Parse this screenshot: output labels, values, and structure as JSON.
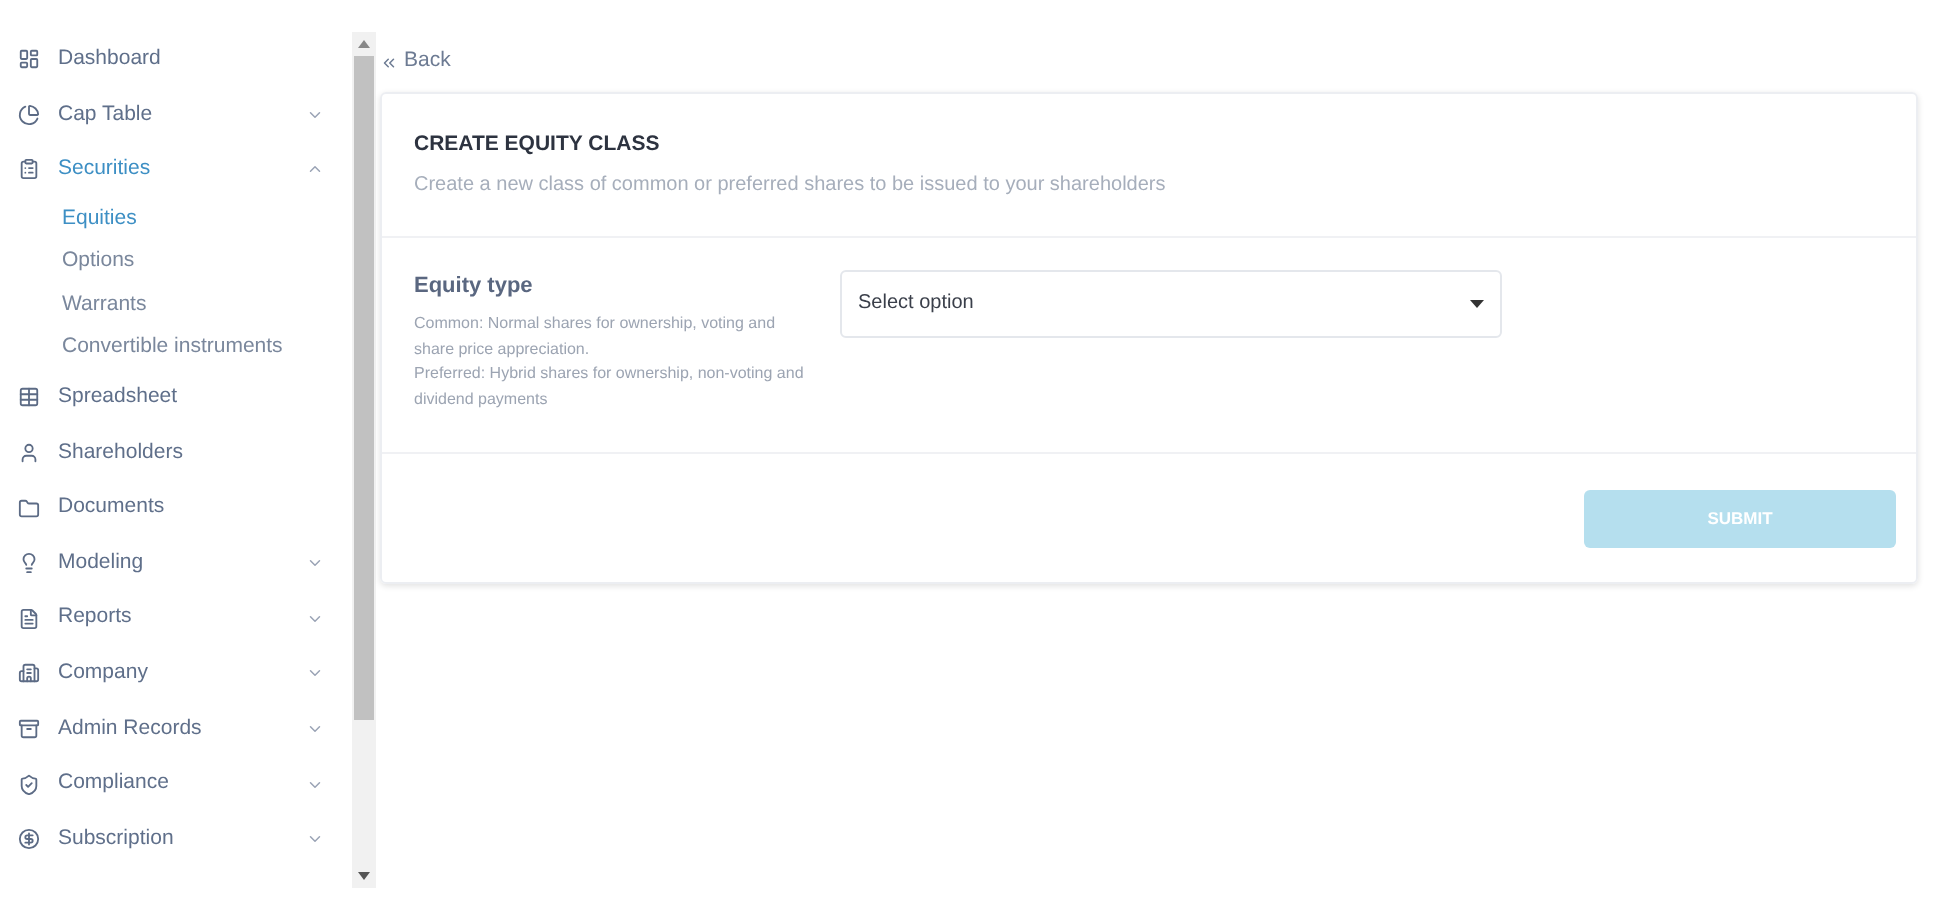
{
  "sidebar": {
    "items": [
      {
        "label": "Dashboard",
        "selected": false
      },
      {
        "label": "Cap Table",
        "selected": false,
        "expanded": false
      },
      {
        "label": "Securities",
        "selected": true,
        "expanded": true,
        "children": [
          {
            "label": "Equities",
            "selected": true
          },
          {
            "label": "Options",
            "selected": false
          },
          {
            "label": "Warrants",
            "selected": false
          },
          {
            "label": "Convertible instruments",
            "selected": false
          }
        ]
      },
      {
        "label": "Spreadsheet",
        "selected": false
      },
      {
        "label": "Shareholders",
        "selected": false
      },
      {
        "label": "Documents",
        "selected": false
      },
      {
        "label": "Modeling",
        "selected": false,
        "expanded": false
      },
      {
        "label": "Reports",
        "selected": false,
        "expanded": false
      },
      {
        "label": "Company",
        "selected": false,
        "expanded": false
      },
      {
        "label": "Admin Records",
        "selected": false,
        "expanded": false
      },
      {
        "label": "Compliance",
        "selected": false,
        "expanded": false
      },
      {
        "label": "Subscription",
        "selected": false,
        "expanded": false
      }
    ]
  },
  "back_link": "Back",
  "card": {
    "title": "CREATE EQUITY CLASS",
    "subtitle": "Create a new class of common or preferred shares to be issued to your shareholders",
    "field": {
      "label": "Equity type",
      "help": [
        "Common: Normal shares for ownership, voting and share price appreciation.",
        "Preferred: Hybrid shares for ownership, non-voting and dividend payments"
      ],
      "placeholder": "Select option"
    },
    "submit": {
      "label": "SUBMIT",
      "disabled": true
    }
  }
}
